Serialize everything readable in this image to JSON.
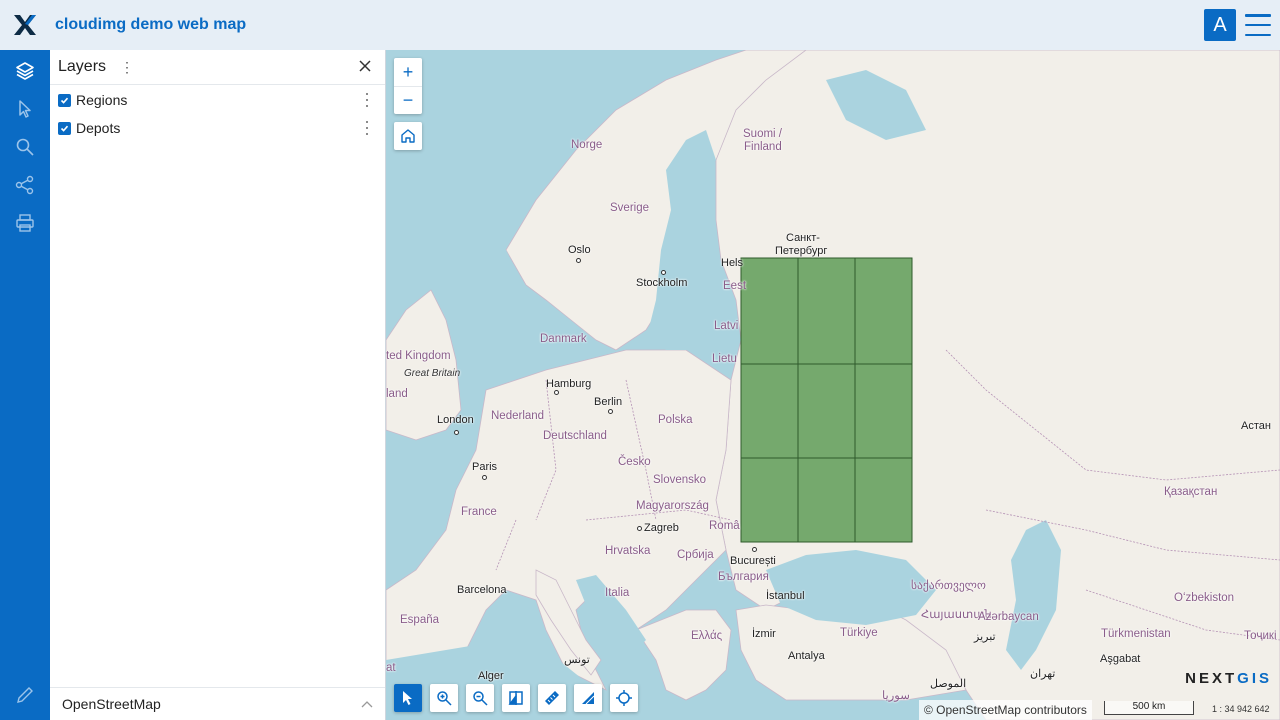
{
  "header": {
    "app_title": "cloudimg demo web map",
    "user_initial": "A"
  },
  "sidebar": {
    "items": [
      {
        "name": "layers",
        "icon": "layers-icon"
      },
      {
        "name": "identify",
        "icon": "cursor-icon"
      },
      {
        "name": "search",
        "icon": "search-icon"
      },
      {
        "name": "share",
        "icon": "share-icon"
      },
      {
        "name": "print",
        "icon": "print-icon"
      }
    ],
    "bottom_icon": "pencil-icon"
  },
  "layers_panel": {
    "title": "Layers",
    "layers": [
      {
        "label": "Regions",
        "checked": true
      },
      {
        "label": "Depots",
        "checked": true
      }
    ],
    "basemap_label": "OpenStreetMap"
  },
  "map": {
    "labels": {
      "norge": "Norge",
      "sverige": "Sverige",
      "suomi": "Suomi /",
      "finland": "Finland",
      "spb1": "Санкт-",
      "spb2": "Петербург",
      "helsinki": "Hels",
      "eesti": "Eest",
      "latvia": "Latvi",
      "lietuva": "Lietu",
      "oslo": "Oslo",
      "stockholm": "Stockholm",
      "danmark": "Danmark",
      "uk": "ted Kingdom",
      "gb": "Great Britain",
      "land": "land",
      "hamburg": "Hamburg",
      "berlin": "Berlin",
      "nederland": "Nederland",
      "polska": "Polska",
      "london": "London",
      "deutschland": "Deutschland",
      "cesko": "Česko",
      "paris": "Paris",
      "slovensko": "Slovensko",
      "magyarorszag": "Magyarország",
      "france": "France",
      "zagreb": "Zagreb",
      "roma": "Româ",
      "hrvatska": "Hrvatska",
      "srbija": "Србија",
      "bucuresti": "București",
      "bulgaria": "България",
      "barcelona": "Barcelona",
      "italia": "Italia",
      "istanbul": "İstanbul",
      "espana": "España",
      "ellas": "Ελλάς",
      "izmir": "İzmir",
      "turkiye": "Türkiye",
      "antalya": "Antalya",
      "tunis": "تونس",
      "alger": "Alger",
      "at": "at",
      "georgia": "საქართველო",
      "armenia": "Հայաստան",
      "azerbaycan": "Azərbaycan",
      "tebriz": "تبریز",
      "astana": "Астан",
      "kazakhstan": "Қазақстан",
      "ozbekiston": "Oʻzbekiston",
      "turkmenistan": "Türkmenistan",
      "tojiki": "Тоҷикі",
      "asgabat": "Aşgabat",
      "tehran": "تهران",
      "mosul": "الموصل",
      "syria": "سوريا"
    },
    "attribution": "© OpenStreetMap contributors",
    "scale_label": "500 km",
    "scale_ratio": "1 : 34 942 642",
    "brand_left": "NEXT",
    "brand_right": "GIS",
    "region_fill": "#75a96d",
    "region_stroke": "#2e5b2b",
    "region_grid": {
      "cols": 3,
      "rows": 3
    }
  }
}
